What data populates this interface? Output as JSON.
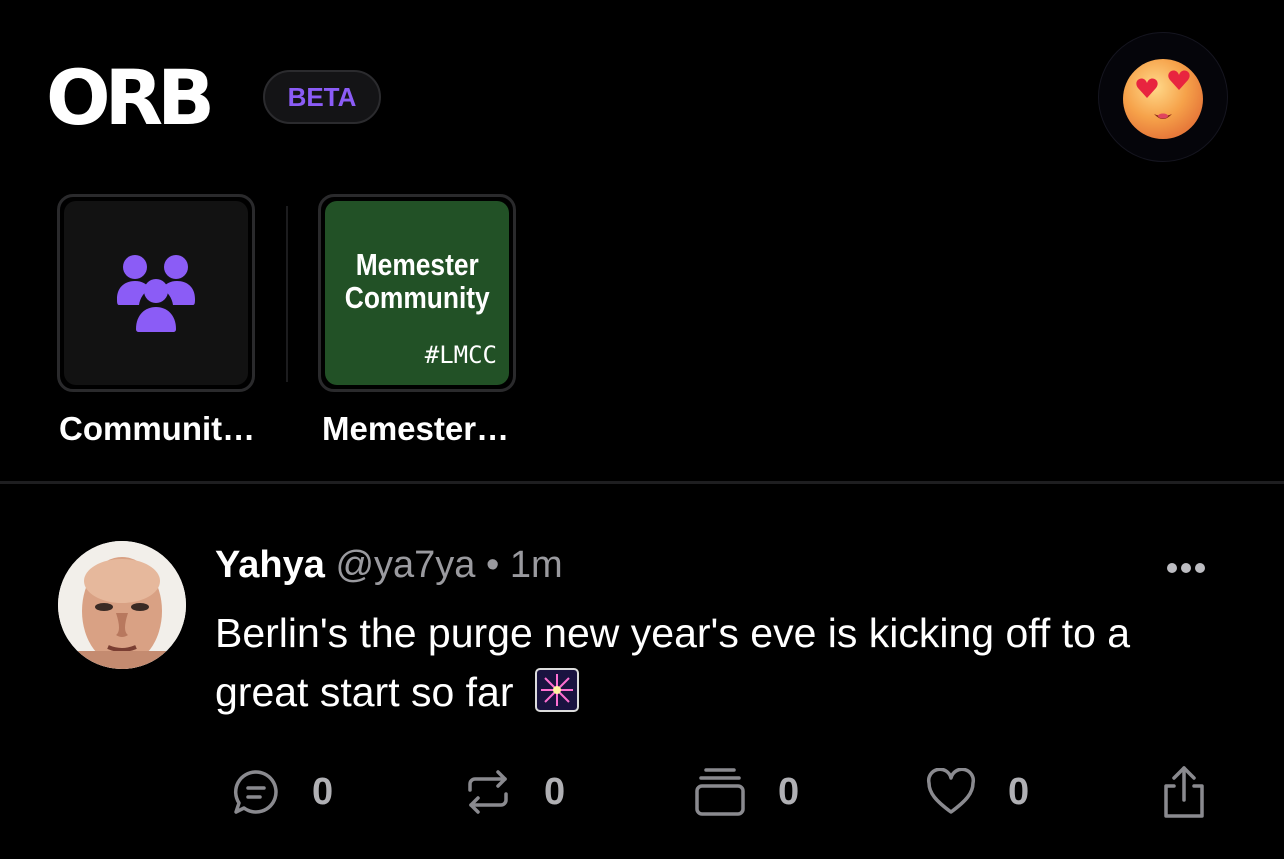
{
  "header": {
    "logo": "ORB",
    "badge": "BETA",
    "avatar_icon": "heart-eyes-emoji-icon"
  },
  "communities": [
    {
      "label": "Communit…",
      "icon": "community-people-icon"
    },
    {
      "label": "Memester…",
      "title_line1": "Memester",
      "title_line2": "Community",
      "tag": "#LMCC"
    }
  ],
  "post": {
    "author": "Yahya",
    "handle": "@ya7ya",
    "separator": "•",
    "time": "1m",
    "text": "Berlin's the purge new year's eve is kicking off to a great start so far",
    "emoji_icon": "fireworks-icon",
    "actions": {
      "comments": "0",
      "reposts": "0",
      "collects": "0",
      "likes": "0"
    }
  },
  "colors": {
    "accent": "#8b5cf6",
    "background": "#000000",
    "muted_text": "#9a9a9f",
    "community_green": "#225126"
  }
}
